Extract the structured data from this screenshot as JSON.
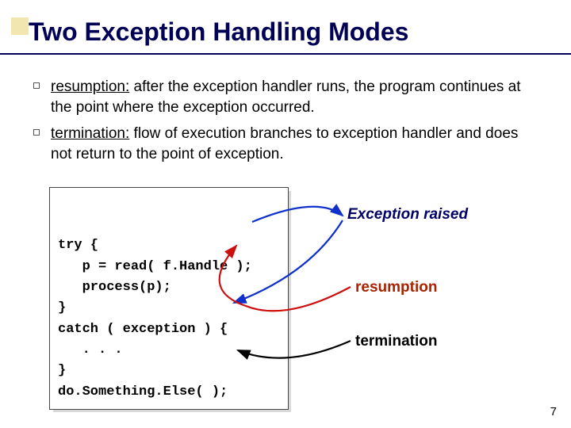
{
  "title": "Two Exception Handling Modes",
  "bullets": [
    {
      "term": "resumption:",
      "text": "  after the exception handler runs, the program continues at the point where the exception occurred."
    },
    {
      "term": "termination:",
      "text": " flow of execution branches to exception handler and does not return to the point of exception."
    }
  ],
  "code": {
    "l1": "try {",
    "l2": "   p = read( f.Handle );",
    "l3": "   process(p);",
    "l4": "}",
    "l5": "catch ( exception ) {",
    "l6": "   . . .",
    "l7": "}",
    "l8": "do.Something.Else( );"
  },
  "labels": {
    "exception": "Exception raised",
    "resumption": "resumption",
    "termination": "termination"
  },
  "page": "7"
}
